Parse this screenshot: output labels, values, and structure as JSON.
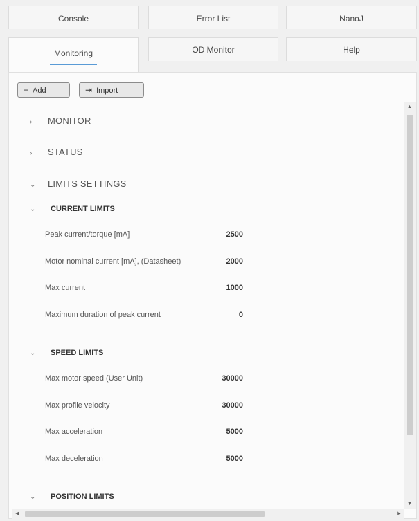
{
  "tabs_row1": [
    {
      "label": "Console"
    },
    {
      "label": "Error List"
    },
    {
      "label": "NanoJ"
    }
  ],
  "tabs_row2": [
    {
      "label": "Monitoring",
      "active": true
    },
    {
      "label": "OD Monitor"
    },
    {
      "label": "Help"
    }
  ],
  "toolbar": {
    "add_label": "Add",
    "add_icon": "plus-icon",
    "import_label": "Import",
    "import_icon": "import-icon"
  },
  "sections": {
    "monitor": "MONITOR",
    "status": "STATUS",
    "limits_settings": "LIMITS SETTINGS"
  },
  "current_limits": {
    "title": "CURRENT LIMITS",
    "rows": [
      {
        "label": "Peak current/torque [mA]",
        "value": "2500"
      },
      {
        "label": "Motor nominal current [mA], (Datasheet)",
        "value": "2000"
      },
      {
        "label": "Max current",
        "value": "1000"
      },
      {
        "label": "Maximum duration of peak current",
        "value": "0"
      }
    ]
  },
  "speed_limits": {
    "title": "SPEED LIMITS",
    "rows": [
      {
        "label": "Max motor speed (User Unit)",
        "value": "30000"
      },
      {
        "label": "Max profile velocity",
        "value": "30000"
      },
      {
        "label": "Max acceleration",
        "value": "5000"
      },
      {
        "label": "Max deceleration",
        "value": "5000"
      }
    ]
  },
  "position_limits": {
    "title": "POSITION LIMITS"
  },
  "colors": {
    "accent": "#5a9bd6",
    "background": "#f0f0f0",
    "panel": "#fbfbfb"
  }
}
